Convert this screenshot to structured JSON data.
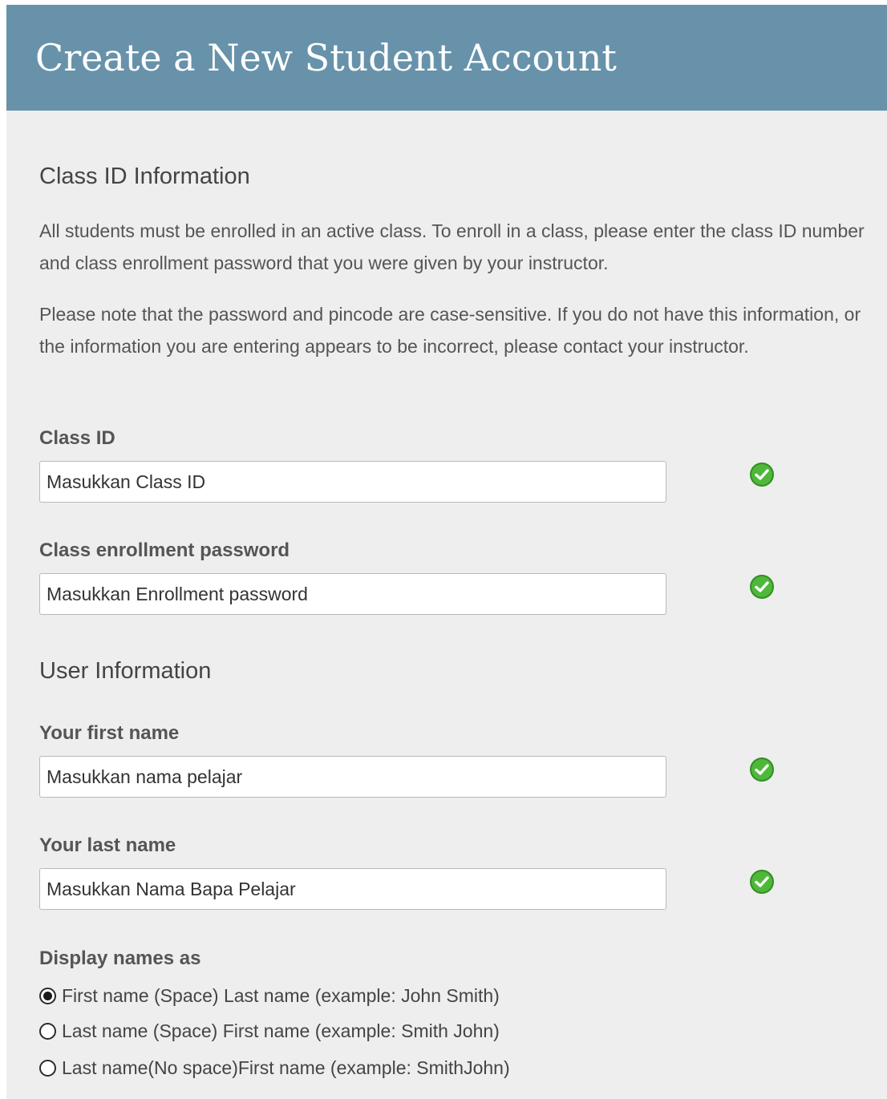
{
  "header": {
    "title": "Create a New Student Account"
  },
  "class_section": {
    "heading": "Class ID Information",
    "paragraph_1": "All students must be enrolled in an active class. To enroll in a class, please enter the class ID number and class enrollment password that you were given by your instructor.",
    "paragraph_2": "Please note that the password and pincode are case-sensitive. If you do not have this information, or the information you are entering appears to be incorrect, please contact your instructor.",
    "class_id": {
      "label": "Class ID",
      "value": "Masukkan Class ID",
      "status_icon": "check-circle-icon"
    },
    "enrollment_password": {
      "label": "Class enrollment password",
      "value": "Masukkan Enrollment password",
      "status_icon": "check-circle-icon"
    }
  },
  "user_section": {
    "heading": "User Information",
    "first_name": {
      "label": "Your first name",
      "value": "Masukkan nama pelajar",
      "status_icon": "check-circle-icon"
    },
    "last_name": {
      "label": "Your last name",
      "value": "Masukkan Nama Bapa Pelajar",
      "status_icon": "check-circle-icon"
    },
    "display_names": {
      "label": "Display names as",
      "options": [
        {
          "label": "First name (Space) Last name (example: John Smith)",
          "selected": true
        },
        {
          "label": "Last name (Space) First name (example: Smith John)",
          "selected": false
        },
        {
          "label": "Last name(No space)First name (example: SmithJohn)",
          "selected": false
        }
      ]
    }
  },
  "colors": {
    "header_bg": "#6792aa",
    "page_bg": "#eeeeee",
    "valid_green": "#3aa62b"
  }
}
